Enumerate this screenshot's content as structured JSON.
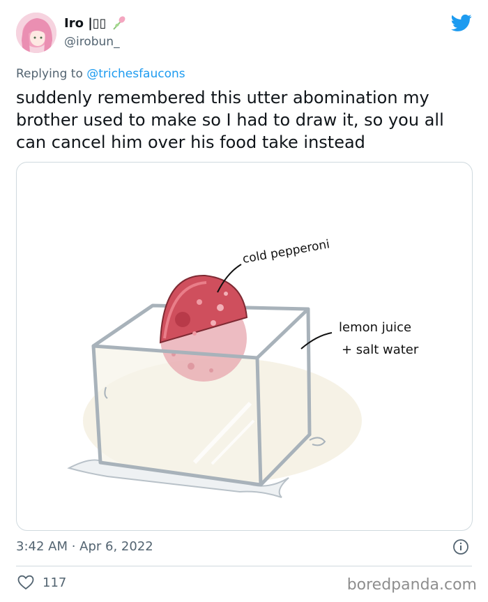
{
  "tweet": {
    "display_name": "Iro |▯▯",
    "handle": "@irobun_",
    "replying_prefix": "Replying to ",
    "replying_to": "@trichesfaucons",
    "text": "suddenly remembered this utter abomination my\nbrother used to make so I had to draw it, so you all\ncan cancel him over his food take instead",
    "timestamp": "3:42 AM · Apr 6, 2022",
    "like_count": "117"
  },
  "drawing": {
    "label_pepperoni": "cold pepperoni",
    "label_liquid_line1": "lemon juice",
    "label_liquid_line2": "+ salt water"
  },
  "watermark": "boredpanda.com",
  "colors": {
    "twitter_blue": "#1d9bf0",
    "secondary_text": "#536471",
    "pepperoni": "#d9505e"
  },
  "icons": [
    "avatar",
    "tulip-emoji-icon",
    "twitter-bird-icon",
    "info-icon",
    "heart-icon"
  ]
}
